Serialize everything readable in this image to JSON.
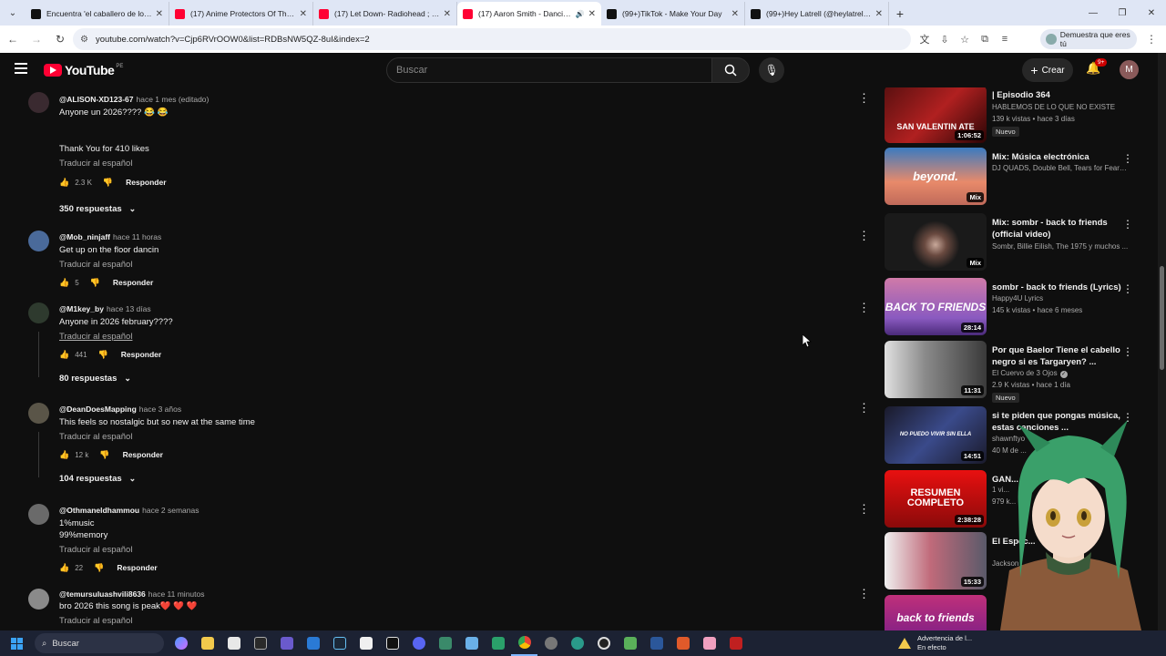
{
  "browser": {
    "tabs": [
      {
        "label": "Encuentra 'el caballero de los 7...",
        "favicon": "tiktok"
      },
      {
        "label": "(17) Anime Protectors Of The E...",
        "favicon": "youtube"
      },
      {
        "label": "(17) Let Down- Radiohead ; Lyr...",
        "favicon": "youtube"
      },
      {
        "label": "(17) Aaron Smith - Dancin (...",
        "favicon": "youtube",
        "active": true
      },
      {
        "label": "(99+)TikTok - Make Your Day",
        "favicon": "tiktok"
      },
      {
        "label": "(99+)Hey Latrell (@heylatrell) |...",
        "favicon": "tiktok"
      }
    ],
    "url": "youtube.com/watch?v=Cjp6RVrOOW0&list=RDBsNW5QZ-8uI&index=2",
    "profile_pill": "Demuestra que eres tú"
  },
  "youtube": {
    "logo_text": "YouTube",
    "country_code": "PE",
    "search_placeholder": "Buscar",
    "create_label": "Crear",
    "notifications_badge": "9+",
    "avatar_letter": "M"
  },
  "comments": [
    {
      "handle": "@ALISON-XD123-67",
      "time": "hace 1 mes (editado)",
      "lines": [
        "Anyone un 2026???? 😂 😂",
        "",
        "",
        "Thank You for 410 likes"
      ],
      "translate": "Traducir al español",
      "likes": "2.3 K",
      "reply_label": "Responder",
      "replies": "350 respuestas"
    },
    {
      "handle": "@Mob_ninjaff",
      "time": "hace 11 horas",
      "lines": [
        "Get up on the floor dancin"
      ],
      "translate": "Traducir al español",
      "likes": "5",
      "reply_label": "Responder"
    },
    {
      "handle": "@M1key_by",
      "time": "hace 13 días",
      "lines": [
        "Anyone in 2026 february????"
      ],
      "translate": "Traducir al español",
      "likes": "441",
      "reply_label": "Responder",
      "replies": "80 respuestas"
    },
    {
      "handle": "@DeanDoesMapping",
      "time": "hace 3 años",
      "lines": [
        "This feels so nostalgic but so new at the same time"
      ],
      "translate": "Traducir al español",
      "likes": "12 k",
      "reply_label": "Responder",
      "replies": "104 respuestas"
    },
    {
      "handle": "@Othmaneldhammou",
      "time": "hace 2 semanas",
      "lines": [
        "1%music",
        "99%memory"
      ],
      "translate": "Traducir al español",
      "likes": "22",
      "reply_label": "Responder"
    },
    {
      "handle": "@temursuluashvili8636",
      "time": "hace 11 minutos",
      "lines": [
        "bro 2026 this song is peak❤️ ❤️ ❤️"
      ],
      "translate": "Traducir al español"
    }
  ],
  "sidebar": [
    {
      "title": "| Episodio 364",
      "channel": "HABLEMOS DE LO QUE NO EXISTE",
      "stats": "139 k vistas • hace 3 días",
      "badge": "Nuevo",
      "duration": "1:06:52",
      "thumb_text": "SAN VALENTIN ATE"
    },
    {
      "title": "Mix: Música electrónica",
      "channel": "DJ QUADS, Double Bell, Tears for Fears y ...",
      "duration": "Mix",
      "thumb_text": "beyond."
    },
    {
      "title": "Mix: sombr - back to friends (official video)",
      "channel": "Sombr, Billie Eilish, The 1975 y muchos ...",
      "duration": "Mix"
    },
    {
      "title": "sombr - back to friends (Lyrics)",
      "channel": "Happy4U Lyrics",
      "stats": "145 k vistas • hace 6 meses",
      "duration": "28:14",
      "thumb_text": "BACK TO FRIENDS"
    },
    {
      "title": "Por que Baelor Tiene el cabello negro si es Targaryen? ...",
      "channel": "El Cuervo de 3 Ojos",
      "stats": "2.9 K vistas • hace 1 día",
      "badge": "Nuevo",
      "duration": "11:31"
    },
    {
      "title": "si te piden que pongas música, estas canciones ...",
      "channel": "shawnftyo",
      "stats": "40 M de ...",
      "duration": "14:51",
      "thumb_text": "NO PUEDO VIVIR SIN ELLA"
    },
    {
      "title": "GAN...",
      "channel": "1 vi...",
      "stats": "979 k...",
      "duration": "2:38:28",
      "thumb_text": "RESUMEN COMPLETO"
    },
    {
      "title": "El Espec...",
      "channel": "Jackson ...",
      "stats": "hazmelo30...",
      "duration": "15:33"
    },
    {
      "title": "",
      "thumb_text": "back to friends"
    }
  ],
  "taskbar": {
    "search_placeholder": "Buscar",
    "alert_title": "Advertencia de l...",
    "alert_sub": "En efecto"
  }
}
